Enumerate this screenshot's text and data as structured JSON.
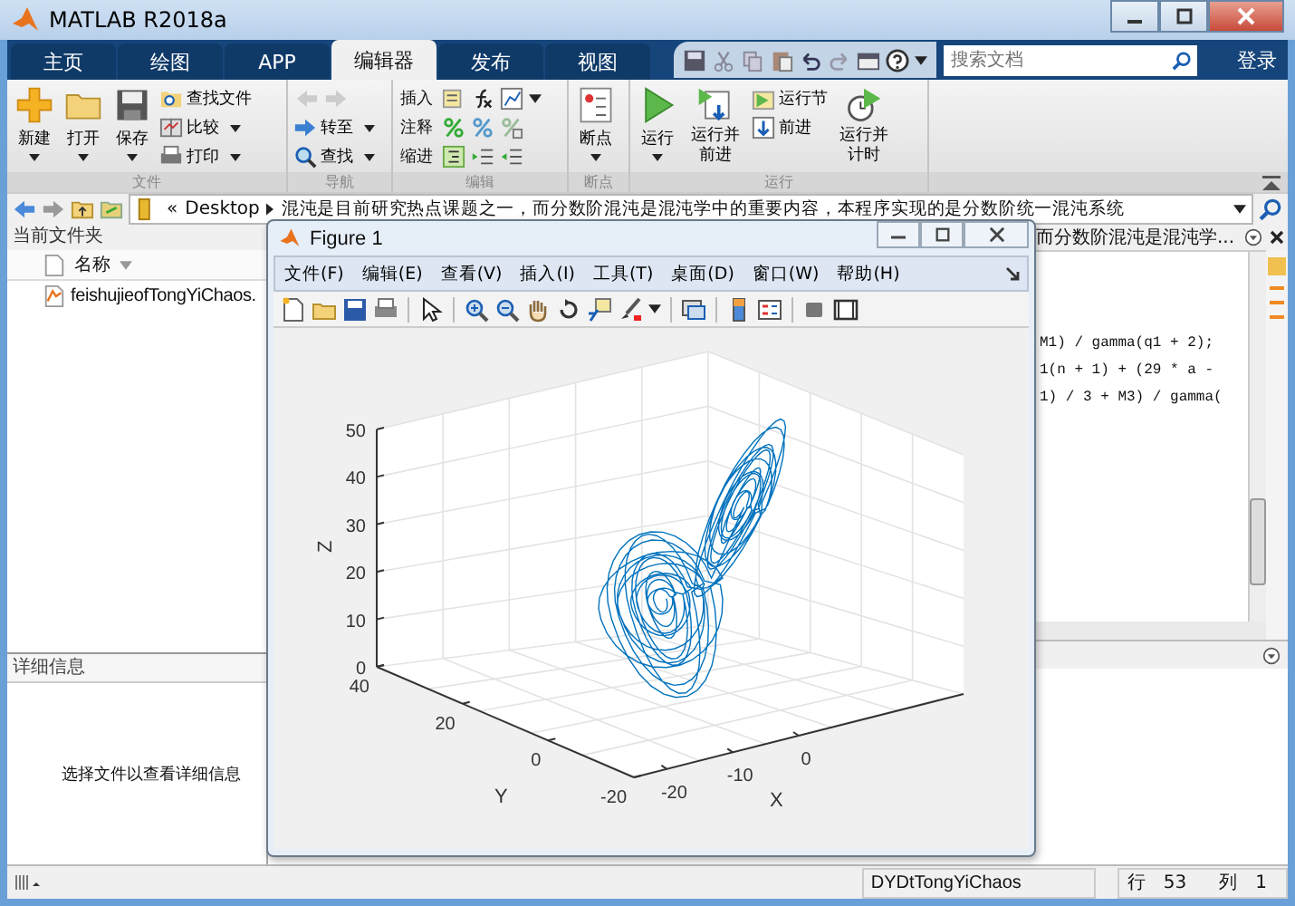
{
  "window": {
    "title": "MATLAB R2018a"
  },
  "tabs": [
    {
      "label": "主页",
      "selected": false
    },
    {
      "label": "绘图",
      "selected": false
    },
    {
      "label": "APP",
      "selected": false
    },
    {
      "label": "编辑器",
      "selected": true
    },
    {
      "label": "发布",
      "selected": false
    },
    {
      "label": "视图",
      "selected": false
    }
  ],
  "quick_access": {
    "search_placeholder": "搜索文档",
    "login": "登录"
  },
  "ribbon": {
    "file": {
      "label": "文件",
      "new": "新建",
      "open": "打开",
      "save": "保存",
      "find_files": "查找文件",
      "compare": "比较",
      "print": "打印"
    },
    "navigate": {
      "label": "导航",
      "go_to": "转至",
      "find": "查找"
    },
    "edit": {
      "label": "编辑",
      "insert": "插入",
      "comment": "注释",
      "indent": "缩进"
    },
    "breakpoints": {
      "label": "断点",
      "breakpoints": "断点"
    },
    "run": {
      "label": "运行",
      "run": "运行",
      "run_and_advance": "运行并前进",
      "run_section": "运行节",
      "advance": "前进",
      "run_and_time": "运行并计时"
    }
  },
  "address_bar": {
    "prefix": "«",
    "folder": "Desktop",
    "path": "混沌是目前研究热点课题之一，而分数阶混沌是混沌学中的重要内容，本程序实现的是分数阶统一混沌系统"
  },
  "current_folder": {
    "title": "当前文件夹",
    "column": "名称",
    "files": [
      "feishujieofTongYiChaos."
    ]
  },
  "details": {
    "title": "详细信息",
    "message": "选择文件以查看详细信息"
  },
  "editor": {
    "tab_title": "而分数阶混沌是混沌学...",
    "code_lines": [
      "M1) / gamma(q1 + 2);",
      "1(n + 1) + (29 * a -",
      "1) / 3 + M3) / gamma("
    ]
  },
  "figure": {
    "title": "Figure 1",
    "menu": [
      "文件(F)",
      "编辑(E)",
      "查看(V)",
      "插入(I)",
      "工具(T)",
      "桌面(D)",
      "窗口(W)",
      "帮助(H)"
    ],
    "plot": {
      "z_label": "Z",
      "y_label": "Y",
      "x_label": "X",
      "z_ticks": [
        "50",
        "40",
        "30",
        "20",
        "10",
        "0"
      ],
      "y_ticks": [
        "40",
        "20",
        "0",
        "-20"
      ],
      "x_ticks": [
        "-20",
        "-10",
        "0"
      ]
    }
  },
  "status_bar": {
    "file": "DYDtTongYiChaos",
    "line_label": "行",
    "line": "53",
    "col_label": "列",
    "col": "1"
  }
}
